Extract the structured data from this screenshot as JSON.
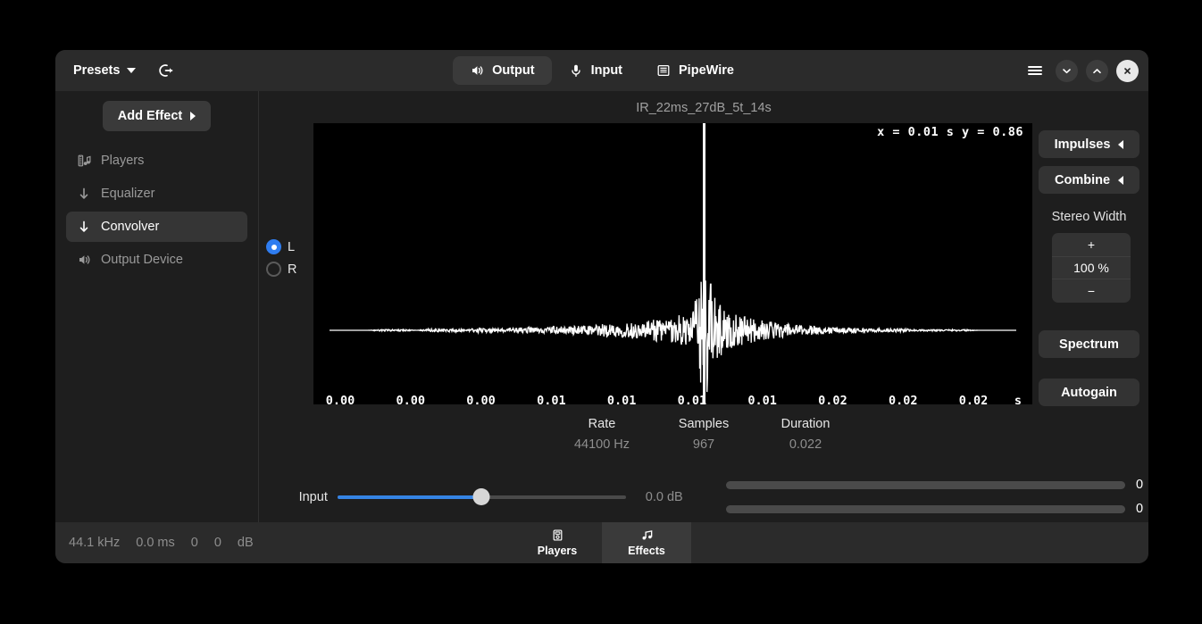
{
  "header": {
    "presets_label": "Presets",
    "presets_caret_icon": "chevron-down-icon",
    "reset_icon": "logout-arrow-icon",
    "tabs": [
      {
        "label": "Output",
        "icon": "speaker-icon",
        "active": true
      },
      {
        "label": "Input",
        "icon": "microphone-icon",
        "active": false
      },
      {
        "label": "PipeWire",
        "icon": "list-icon",
        "active": false
      }
    ],
    "window_controls": [
      {
        "name": "menu-button",
        "icon": "hamburger-icon"
      },
      {
        "name": "minimize-button",
        "icon": "chevron-down-icon"
      },
      {
        "name": "maximize-button",
        "icon": "chevron-up-icon"
      },
      {
        "name": "close-button",
        "icon": "close-x-icon"
      }
    ]
  },
  "sidebar": {
    "add_effect_label": "Add Effect",
    "add_effect_caret_icon": "chevron-right-icon",
    "items": [
      {
        "label": "Players",
        "icon": "music-player-icon",
        "active": false
      },
      {
        "label": "Equalizer",
        "icon": "down-arrow-icon",
        "active": false
      },
      {
        "label": "Convolver",
        "icon": "down-arrow-icon",
        "active": true
      },
      {
        "label": "Output Device",
        "icon": "speaker-icon",
        "active": false
      }
    ]
  },
  "main": {
    "plot_title": "IR_22ms_27dB_5t_14s",
    "readout": "x = 0.01 s  y = 0.86",
    "channels": [
      {
        "label": "L",
        "selected": true
      },
      {
        "label": "R",
        "selected": false
      }
    ],
    "right_panel": {
      "impulses_label": "Impulses",
      "impulses_caret_icon": "chevron-left-icon",
      "combine_label": "Combine",
      "combine_caret_icon": "chevron-left-icon",
      "stereo_width_label": "Stereo Width",
      "stereo_width_plus": "+",
      "stereo_width_value": "100 %",
      "stereo_width_minus": "−",
      "spectrum_label": "Spectrum",
      "autogain_label": "Autogain"
    },
    "stats": [
      {
        "key": "Rate",
        "value": "44100 Hz"
      },
      {
        "key": "Samples",
        "value": "967"
      },
      {
        "key": "Duration",
        "value": "0.022"
      }
    ],
    "input": {
      "label": "Input",
      "gain_value": "0.0 dB",
      "slider_percent": 50
    },
    "meters": [
      {
        "value": "0"
      },
      {
        "value": "0"
      }
    ]
  },
  "footer": {
    "status": [
      "44.1 kHz",
      "0.0 ms",
      "0",
      "0",
      "dB"
    ],
    "tabs": [
      {
        "label": "Players",
        "icon": "music-player-icon",
        "active": false
      },
      {
        "label": "Effects",
        "icon": "music-note-icon",
        "active": true
      }
    ]
  },
  "colors": {
    "accent": "#3584e4",
    "window_bg": "#1e1e1e",
    "header_bg": "#2b2b2b",
    "plot_bg": "#000000",
    "plot_line": "#ffffff"
  },
  "chart_data": {
    "type": "line",
    "title": "IR_22ms_27dB_5t_14s",
    "xlabel": "s",
    "ylabel": "",
    "grid": false,
    "legend": null,
    "xticks": [
      "0.00",
      "0.00",
      "0.00",
      "0.01",
      "0.01",
      "0.01",
      "0.01",
      "0.02",
      "0.02",
      "0.02"
    ],
    "xlim": [
      0.0,
      0.022
    ],
    "ylim": [
      -1.0,
      1.0
    ],
    "cursor": {
      "x": 0.01,
      "y": 0.86,
      "label": "x = 0.01 s  y = 0.86"
    },
    "annotations": [
      "Impulse response waveform, near-silent tail with a large transient spike near the centre"
    ],
    "series": [
      {
        "name": "L",
        "x": [
          0.0,
          0.0004,
          0.0008,
          0.0012,
          0.0016,
          0.002,
          0.0024,
          0.0028,
          0.0032,
          0.0036,
          0.004,
          0.0044,
          0.0048,
          0.0052,
          0.0056,
          0.006,
          0.0064,
          0.0068,
          0.0072,
          0.0076,
          0.008,
          0.0084,
          0.0088,
          0.0092,
          0.0096,
          0.01,
          0.0104,
          0.0108,
          0.0112,
          0.0116,
          0.012,
          0.0124,
          0.0128,
          0.0132,
          0.0136,
          0.014,
          0.0144,
          0.0148,
          0.0152,
          0.0156,
          0.016,
          0.0164,
          0.0168,
          0.0172,
          0.0176,
          0.018,
          0.0184,
          0.0188,
          0.0192,
          0.0196,
          0.02,
          0.0204,
          0.0208,
          0.0212,
          0.0216,
          0.022
        ],
        "values": [
          0.0,
          0.0,
          0.0,
          0.0,
          0.01,
          -0.01,
          0.01,
          0.0,
          0.02,
          -0.02,
          0.02,
          -0.01,
          0.03,
          -0.02,
          0.02,
          -0.03,
          0.04,
          -0.03,
          0.05,
          -0.04,
          0.06,
          -0.05,
          0.08,
          -0.07,
          0.1,
          -0.09,
          0.13,
          -0.12,
          0.18,
          -0.16,
          0.86,
          -0.34,
          0.22,
          -0.18,
          0.14,
          -0.11,
          0.09,
          -0.07,
          0.06,
          -0.05,
          0.04,
          -0.03,
          0.03,
          -0.02,
          0.02,
          -0.02,
          0.02,
          -0.01,
          0.01,
          -0.01,
          0.01,
          -0.01,
          0.0,
          0.0,
          0.0,
          0.0
        ]
      }
    ]
  }
}
